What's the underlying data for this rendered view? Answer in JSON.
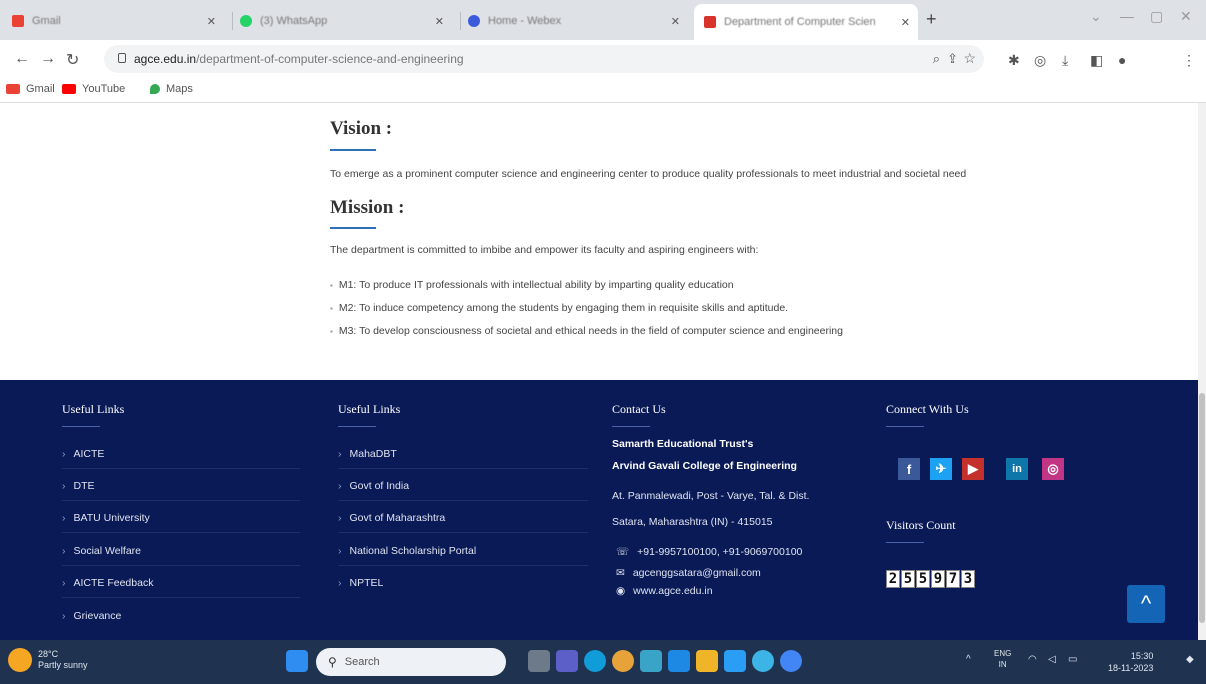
{
  "browser": {
    "tabs": [
      {
        "label": "Gmail",
        "color": "#ea4335"
      },
      {
        "label": "(3) WhatsApp",
        "color": "#25d366"
      },
      {
        "label": "Home - Webex",
        "color": "#3b5bdb"
      },
      {
        "label": "Department of Computer Scien",
        "color": "#d9342b"
      }
    ],
    "new_tab": "+",
    "url_domain": "agce.edu.in",
    "url_path": "/department-of-computer-science-and-engineering",
    "bookmarks": [
      {
        "label": "Gmail",
        "color": "#ea4335"
      },
      {
        "label": "YouTube",
        "color": "#ff0000"
      },
      {
        "label": "Maps",
        "color": "#34a853"
      }
    ]
  },
  "main": {
    "vision_title": "Vision :",
    "vision_text": "To emerge as a prominent computer science and engineering center to produce quality professionals to meet industrial and societal need",
    "mission_title": "Mission :",
    "mission_intro": "The department is committed to imbibe and empower its faculty and aspiring engineers with:",
    "mission_items": [
      "M1: To produce IT professionals with intellectual ability by imparting quality education",
      "M2: To induce competency among the students by engaging them in requisite skills and aptitude.",
      "M3: To develop consciousness of societal and ethical needs in the field of computer science and engineering"
    ]
  },
  "footer": {
    "col1_title": "Useful Links",
    "col1_links": [
      "AICTE",
      "DTE",
      "BATU University",
      "Social Welfare",
      "AICTE Feedback",
      "Grievance"
    ],
    "col2_title": "Useful Links",
    "col2_links": [
      "MahaDBT",
      "Govt of India",
      "Govt of Maharashtra",
      "National Scholarship Portal",
      "NPTEL"
    ],
    "contact_title": "Contact Us",
    "contact_org1": "Samarth Educational Trust's",
    "contact_org2": "Arvind Gavali College of Engineering",
    "contact_addr1": "At. Panmalewadi, Post - Varye, Tal. & Dist.",
    "contact_addr2": "Satara, Maharashtra (IN) - 415015",
    "contact_phone": "+91-9957100100, +91-9069700100",
    "contact_email": "agcenggsatara@gmail.com",
    "contact_web": "www.agce.edu.in",
    "connect_title": "Connect With Us",
    "social": [
      {
        "name": "facebook",
        "glyph": "f",
        "color": "#3b5998"
      },
      {
        "name": "twitter",
        "glyph": "✈",
        "color": "#1da1f2"
      },
      {
        "name": "youtube",
        "glyph": "▶",
        "color": "#c4302b"
      },
      {
        "name": "linkedin",
        "glyph": "in",
        "color": "#0e76a8"
      },
      {
        "name": "instagram",
        "glyph": "◎",
        "color": "#c13584"
      }
    ],
    "visitors_title": "Visitors Count",
    "visitors_digits": [
      "2",
      "5",
      "5",
      "9",
      "7",
      "3"
    ],
    "back_to_top": "^"
  },
  "taskbar": {
    "weather_temp": "28°C",
    "weather_text": "Partly sunny",
    "search_placeholder": "Search",
    "lang1": "ENG",
    "lang2": "IN",
    "time": "15:30",
    "date": "18-11-2023"
  }
}
